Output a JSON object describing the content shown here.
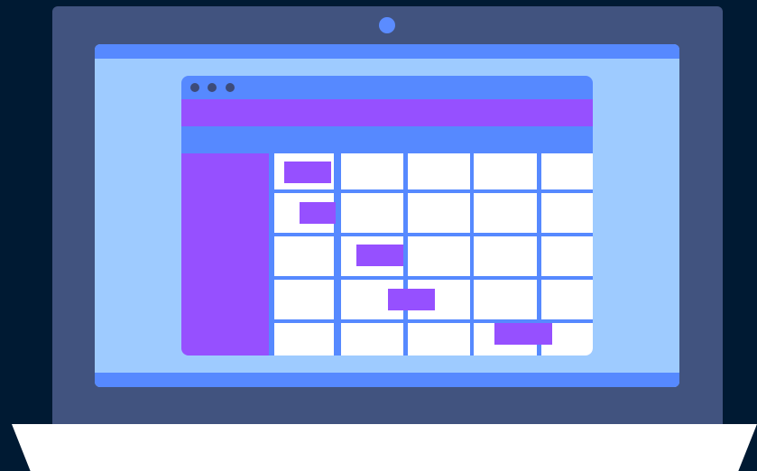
{
  "colors": {
    "background": "#001a33",
    "laptop_lid": "#41537f",
    "camera": "#5b8cff",
    "screen": "#9ecbff",
    "screen_bar": "#5689ff",
    "window_titlebar": "#5689ff",
    "window_dot": "#3d4b7a",
    "header_purple": "#9650ff",
    "toolbar_blue": "#5689ff",
    "sidebar_purple": "#9650ff",
    "grid_line": "#5689ff",
    "cell": "#ffffff",
    "event": "#9650ff",
    "laptop_base": "#ffffff"
  },
  "illustration": {
    "subject": "laptop-showing-calendar-app",
    "window_controls": [
      "dot",
      "dot",
      "dot"
    ],
    "calendar_columns": 5,
    "calendar_rows": 5,
    "event_count": 5
  }
}
